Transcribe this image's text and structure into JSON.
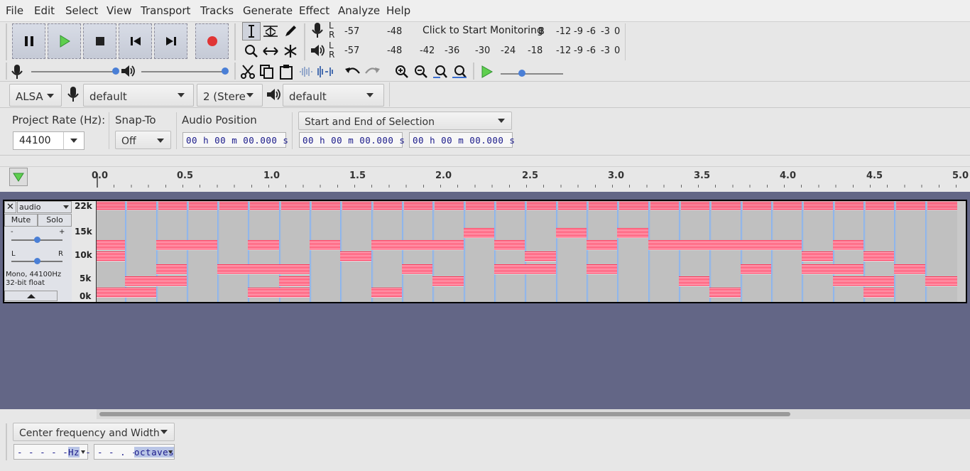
{
  "menu": [
    "File",
    "Edit",
    "Select",
    "View",
    "Transport",
    "Tracks",
    "Generate",
    "Effect",
    "Analyze",
    "Help"
  ],
  "meters": {
    "rec_lr": "L\nR",
    "rec_ticks": [
      "-57",
      "-48",
      "-12",
      "-9",
      "-6",
      "-3",
      "0"
    ],
    "rec_overlay": "Click to Start Monitoring",
    "rec_overlay_tail": "B",
    "play_ticks": [
      "-57",
      "-48",
      "-42",
      "-36",
      "-30",
      "-24",
      "-18",
      "-12",
      "-9",
      "-6",
      "-3",
      "0"
    ]
  },
  "device": {
    "host": "ALSA",
    "rec_device": "default",
    "channels": "2 (Stere",
    "play_device": "default"
  },
  "selection": {
    "rate_label": "Project Rate (Hz):",
    "rate_value": "44100",
    "snap_label": "Snap-To",
    "snap_value": "Off",
    "audio_pos_label": "Audio Position",
    "sel_mode": "Start and End of Selection",
    "time1": "00 h 00 m 00.000 s",
    "time2": "00 h 00 m 00.000 s",
    "time3": "00 h 00 m 00.000 s"
  },
  "ruler": [
    "0.0",
    "0.5",
    "1.0",
    "1.5",
    "2.0",
    "2.5",
    "3.0",
    "3.5",
    "4.0",
    "4.5",
    "5.0"
  ],
  "track": {
    "name": "audio",
    "mute": "Mute",
    "solo": "Solo",
    "gain_minus": "-",
    "gain_plus": "+",
    "pan_l": "L",
    "pan_r": "R",
    "info1": "Mono, 44100Hz",
    "info2": "32-bit float",
    "scale": [
      "22k",
      "15k",
      "10k",
      "5k",
      "0k"
    ]
  },
  "spectral": {
    "mode": "Center frequency and Width",
    "freq_value": "- - - - - . - -",
    "freq_unit": "Hz",
    "width_value": "- - . - - -",
    "width_unit": "octaves"
  },
  "colors": {
    "spectrogram_bg": "#c0c0c0",
    "spectrogram_line": "#ff2a4e",
    "empty_area": "#636686"
  }
}
